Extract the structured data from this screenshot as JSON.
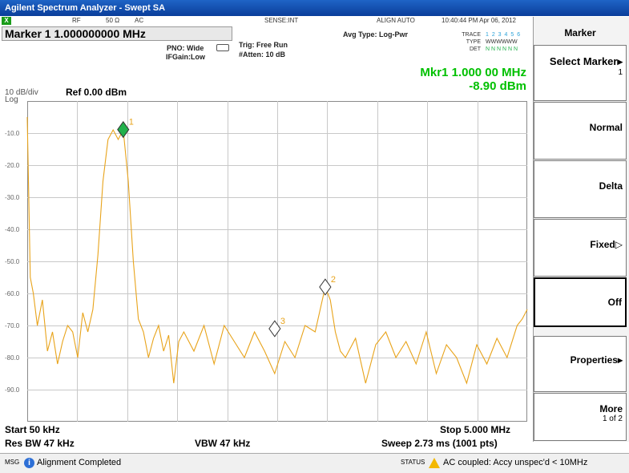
{
  "window": {
    "title": "Agilent Spectrum Analyzer - Swept SA"
  },
  "inforow": {
    "rf": "RF",
    "impedance": "50 Ω",
    "coupling": "AC",
    "sense": "SENSE:INT",
    "align": "ALIGN AUTO",
    "datetime": "10:40:44 PM Apr 06, 2012"
  },
  "marker_title": "Marker 1 1.000000000 MHz",
  "settings": {
    "pno": "PNO: Wide",
    "ifgain": "IFGain:Low",
    "trig": "Trig: Free Run",
    "atten": "#Atten: 10 dB",
    "avg_type": "Avg Type: Log-Pwr"
  },
  "trace": {
    "trace_label": "TRACE",
    "trace_nums": "1 2 3 4 5 6",
    "type_label": "TYPE",
    "type_val": "WWWWWW",
    "det_label": "DET",
    "det_val": "N N N N N N"
  },
  "readout": {
    "freq": "Mkr1 1.000 00 MHz",
    "ampl": "-8.90 dBm"
  },
  "scale": {
    "div": "10 dB/div",
    "log": "Log",
    "ref": "Ref 0.00 dBm"
  },
  "bottom": {
    "start": "Start 50 kHz",
    "stop": "Stop 5.000 MHz",
    "rbw": "Res BW 47 kHz",
    "vbw": "VBW 47 kHz",
    "sweep": "Sweep  2.73 ms (1001 pts)"
  },
  "softkeys": {
    "header": "Marker",
    "select": "Select Marker",
    "select_val": "1",
    "normal": "Normal",
    "delta": "Delta",
    "fixed": "Fixed",
    "off": "Off",
    "properties": "Properties",
    "more": "More",
    "more_sub": "1 of 2"
  },
  "status": {
    "msg_label": "MSG",
    "message": "Alignment Completed",
    "status_label": "STATUS",
    "status_msg": "AC coupled: Accy unspec'd < 10MHz"
  },
  "colors": {
    "trace": "#e8a31a",
    "marker_active": "#22b14c",
    "readout": "#00c000"
  },
  "chart_data": {
    "type": "line",
    "xlim": [
      0.05,
      5.0
    ],
    "ylim": [
      -100,
      0
    ],
    "y_ticks": [
      "-10.0",
      "-20.0",
      "-30.0",
      "-40.0",
      "-50.0",
      "-60.0",
      "-70.0",
      "-80.0",
      "-90.0"
    ],
    "x": [
      0.05,
      0.08,
      0.11,
      0.15,
      0.2,
      0.25,
      0.3,
      0.35,
      0.4,
      0.45,
      0.5,
      0.55,
      0.6,
      0.65,
      0.7,
      0.75,
      0.8,
      0.85,
      0.9,
      0.95,
      1.0,
      1.05,
      1.1,
      1.15,
      1.2,
      1.25,
      1.3,
      1.35,
      1.4,
      1.45,
      1.5,
      1.55,
      1.6,
      1.7,
      1.8,
      1.9,
      2.0,
      2.1,
      2.2,
      2.3,
      2.4,
      2.5,
      2.6,
      2.7,
      2.8,
      2.9,
      2.95,
      3.0,
      3.05,
      3.1,
      3.15,
      3.2,
      3.3,
      3.4,
      3.5,
      3.6,
      3.7,
      3.8,
      3.9,
      4.0,
      4.1,
      4.2,
      4.3,
      4.4,
      4.5,
      4.6,
      4.7,
      4.8,
      4.9,
      4.95,
      5.0
    ],
    "y": [
      -5,
      -55,
      -60,
      -70,
      -62,
      -78,
      -72,
      -82,
      -75,
      -70,
      -72,
      -80,
      -66,
      -72,
      -65,
      -48,
      -25,
      -12,
      -9,
      -12,
      -9,
      -25,
      -50,
      -68,
      -72,
      -80,
      -74,
      -70,
      -78,
      -73,
      -88,
      -75,
      -72,
      -78,
      -70,
      -82,
      -70,
      -75,
      -80,
      -72,
      -78,
      -85,
      -75,
      -80,
      -70,
      -72,
      -65,
      -58,
      -62,
      -72,
      -78,
      -80,
      -74,
      -88,
      -76,
      -72,
      -80,
      -75,
      -82,
      -72,
      -85,
      -76,
      -80,
      -88,
      -76,
      -82,
      -74,
      -80,
      -70,
      -68,
      -65
    ],
    "markers": [
      {
        "label": "1",
        "x": 1.0,
        "y": -8.9,
        "active": true
      },
      {
        "label": "2",
        "x": 3.0,
        "y": -58,
        "active": false
      },
      {
        "label": "3",
        "x": 2.5,
        "y": -71,
        "active": false
      }
    ]
  }
}
